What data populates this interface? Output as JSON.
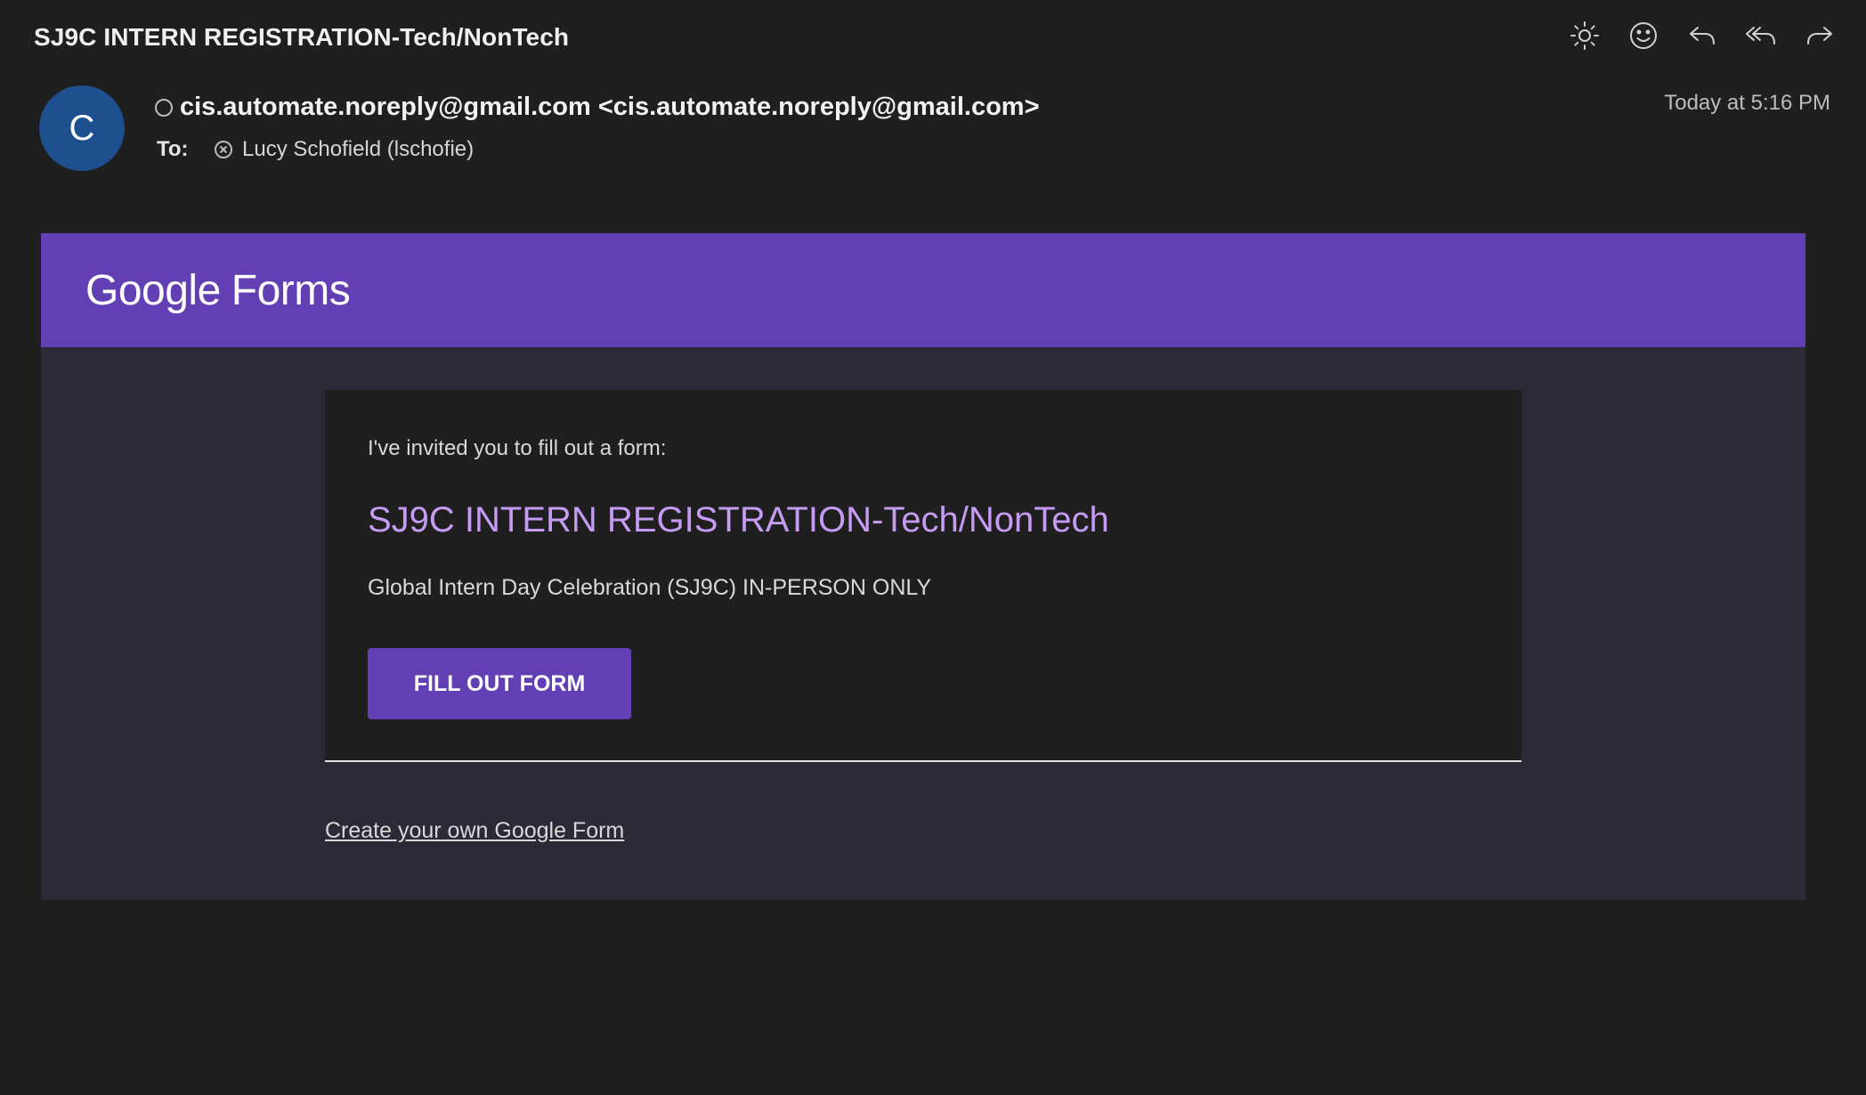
{
  "header": {
    "subject": "SJ9C INTERN REGISTRATION-Tech/NonTech",
    "toolbar_icons": [
      "brightness-icon",
      "emoji-icon",
      "reply-icon",
      "reply-all-icon",
      "forward-icon"
    ]
  },
  "message": {
    "avatar_initial": "C",
    "from": "cis.automate.noreply@gmail.com <cis.automate.noreply@gmail.com>",
    "to_label": "To:",
    "recipient": "Lucy Schofield (lschofie)",
    "date": "Today at 5:16 PM"
  },
  "body": {
    "brand_google": "Google",
    "brand_forms": "Forms",
    "intro": "I've invited you to fill out a form:",
    "form_title": "SJ9C INTERN REGISTRATION-Tech/NonTech",
    "form_description": "Global Intern Day Celebration (SJ9C) IN-PERSON ONLY",
    "fill_button": "FILL OUT FORM",
    "create_link": "Create your own Google Form"
  },
  "colors": {
    "background": "#1f1f1f",
    "brand_purple": "#6240b3",
    "title_purple": "#c59bf3",
    "avatar_blue": "#1e4f8f"
  }
}
